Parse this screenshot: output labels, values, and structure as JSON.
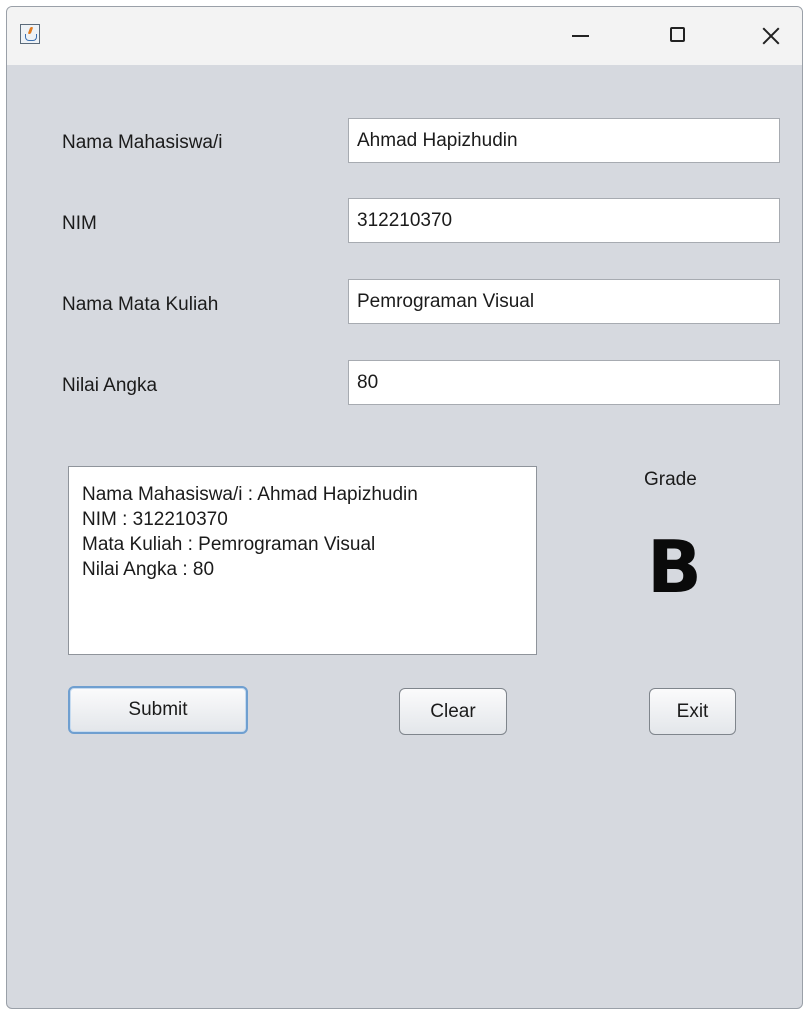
{
  "window": {
    "controls": {
      "minimize_icon": "minimize-icon",
      "maximize_icon": "maximize-icon",
      "close_icon": "close-icon"
    }
  },
  "form": {
    "fields": [
      {
        "label": "Nama Mahasiswa/i",
        "value": "Ahmad Hapizhudin"
      },
      {
        "label": "NIM",
        "value": "312210370"
      },
      {
        "label": "Nama Mata Kuliah",
        "value": "Pemrograman Visual"
      },
      {
        "label": "Nilai Angka",
        "value": "80"
      }
    ]
  },
  "output": {
    "text": "Nama Mahasiswa/i : Ahmad Hapizhudin\nNIM : 312210370\nMata Kuliah : Pemrograman Visual\nNilai Angka : 80"
  },
  "grade": {
    "label": "Grade",
    "value": "B"
  },
  "buttons": {
    "submit": "Submit",
    "clear": "Clear",
    "exit": "Exit"
  },
  "colors": {
    "window_bg": "#d6d9df",
    "titlebar_bg": "#f3f3f3",
    "focus_border": "#6f9fd0"
  }
}
